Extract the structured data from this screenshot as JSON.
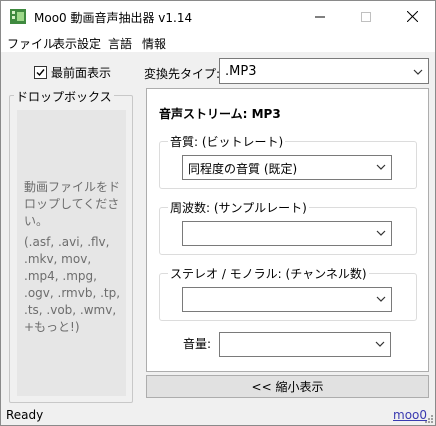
{
  "window": {
    "title": "Moo0 動画音声抽出器 v1.14"
  },
  "icons": [
    "app-icon",
    "minimize-icon",
    "maximize-icon",
    "close-icon",
    "checkmark-icon",
    "chevron-down-icon",
    "resize-grip-icon"
  ],
  "menu": [
    "ファイル",
    "表示設定",
    "言語",
    "情報"
  ],
  "always_on_top": {
    "label": "最前面表示",
    "checked": true
  },
  "dropbox": {
    "legend": "ドロップボックス",
    "message": "動画ファイルをドロップしてください。",
    "extensions": "(.asf, .avi, .flv, .mkv, mov, .mp4, .mpg, .ogv, .rmvb, .tp, .ts, .vob, .wmv, +もっと!)"
  },
  "format": {
    "label": "変換先タイプ:",
    "value": ".MP3"
  },
  "stream": {
    "title": "音声ストリーム:  MP3",
    "quality": {
      "label": "音質: (ビットレート)",
      "value": "同程度の音質 (既定)"
    },
    "frequency": {
      "label": "周波数: (サンプルレート)",
      "value": ""
    },
    "channels": {
      "label": "ステレオ / モノラル: (チャンネル数)",
      "value": ""
    },
    "volume": {
      "label": "音量:",
      "value": ""
    }
  },
  "shrink_button": "<< 縮小表示",
  "status": {
    "text": "Ready",
    "link": "moo0"
  },
  "colors": {
    "link": "#3a3ab0",
    "hint_text": "#6d6d6d",
    "dropbox_bg": "#e6e6e6"
  }
}
